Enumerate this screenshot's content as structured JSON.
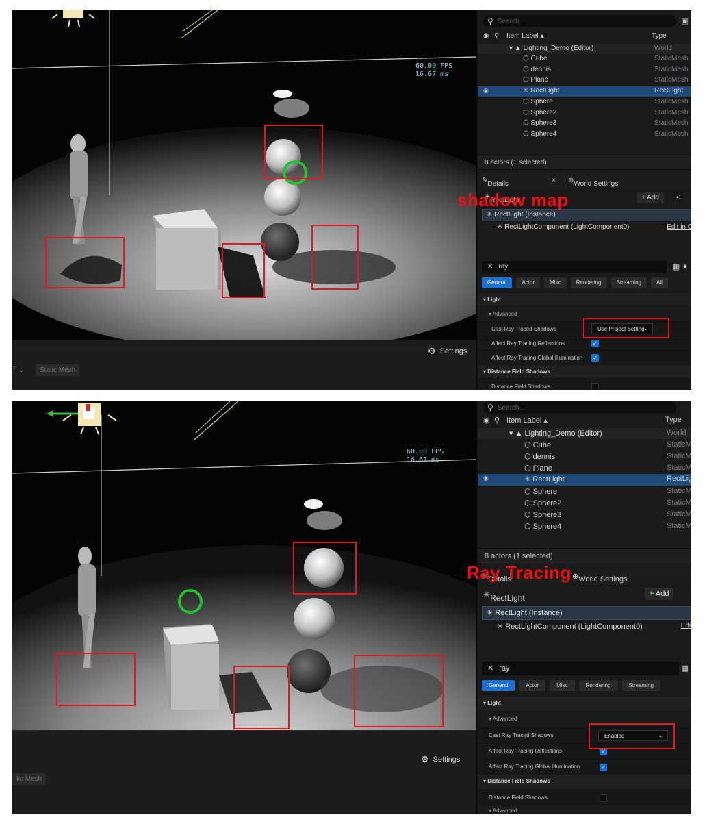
{
  "top": {
    "annotation": "shadow map",
    "viewport": {
      "fps": "60.00 FPS",
      "ms": "16.67 ms"
    },
    "toolbar": {
      "settings_label": "Settings",
      "static_mesh_label": "Static Mesh"
    },
    "outliner": {
      "search_placeholder": "Search...",
      "col_label": "Item Label ▴",
      "col_type": "Type",
      "rows": [
        {
          "label": "Lighting_Demo (Editor)",
          "type": "World"
        },
        {
          "label": "Cube",
          "type": "StaticMesh"
        },
        {
          "label": "dennis",
          "type": "StaticMesh"
        },
        {
          "label": "Plane",
          "type": "StaticMesh"
        },
        {
          "label": "RectLight",
          "type": "RectLight"
        },
        {
          "label": "Sphere",
          "type": "StaticMesh"
        },
        {
          "label": "Sphere2",
          "type": "StaticMesh"
        },
        {
          "label": "Sphere3",
          "type": "StaticMesh"
        },
        {
          "label": "Sphere4",
          "type": "StaticMesh"
        }
      ],
      "count": "8 actors (1 selected)"
    },
    "details": {
      "tab_details": "Details",
      "tab_world": "World Settings",
      "object_name": "RectLight",
      "add_label": "Add",
      "instance": "RectLight (Instance)",
      "component": "RectLightComponent (LightComponent0)",
      "edit_link": "Edit in C",
      "filter": "ray",
      "categories": [
        "General",
        "Actor",
        "Misc",
        "Rendering",
        "Streaming",
        "All"
      ],
      "section_light": "Light",
      "sub_advanced": "Advanced",
      "prop_cast": "Cast Ray Traced Shadows",
      "prop_cast_value": "Use Project Setting",
      "prop_refl": "Affect Ray Tracing Reflections",
      "prop_gi": "Affect Ray Tracing Global Illumination",
      "section_dfs": "Distance Field Shadows",
      "prop_dfs": "Distance Field Shadows"
    }
  },
  "bottom": {
    "annotation": "Ray Tracing",
    "viewport": {
      "fps": "60.00 FPS",
      "ms": "16.67 ms"
    },
    "toolbar": {
      "settings_label": "Settings",
      "static_mesh_label": "tic Mesh"
    },
    "outliner": {
      "search_placeholder": "Search...",
      "col_label": "Item Label ▴",
      "col_type": "Type",
      "rows": [
        {
          "label": "Lighting_Demo (Editor)",
          "type": "World"
        },
        {
          "label": "Cube",
          "type": "StaticM"
        },
        {
          "label": "dennis",
          "type": "StaticM"
        },
        {
          "label": "Plane",
          "type": "StaticM"
        },
        {
          "label": "RectLight",
          "type": "RectLig"
        },
        {
          "label": "Sphere",
          "type": "StaticM"
        },
        {
          "label": "Sphere2",
          "type": "StaticM"
        },
        {
          "label": "Sphere3",
          "type": "StaticM"
        },
        {
          "label": "Sphere4",
          "type": "StaticM"
        }
      ],
      "count": "8 actors (1 selected)"
    },
    "details": {
      "tab_details": "Details",
      "tab_world": "World Settings",
      "object_name": "RectLight",
      "add_label": "Add",
      "instance": "RectLight (Instance)",
      "component": "RectLightComponent (LightComponent0)",
      "edit_link": "Edit",
      "filter": "ray",
      "categories": [
        "General",
        "Actor",
        "Misc",
        "Rendering",
        "Streaming"
      ],
      "section_light": "Light",
      "sub_advanced": "Advanced",
      "prop_cast": "Cast Ray Traced Shadows",
      "prop_cast_value": "Enabled",
      "prop_refl": "Affect Ray Tracing Reflections",
      "prop_gi": "Affect Ray Tracing Global Illumination",
      "section_dfs": "Distance Field Shadows",
      "prop_dfs": "Distance Field Shadows",
      "sub_advanced2": "Advanced"
    }
  },
  "colors": {
    "annotation_red": "#e01b1b",
    "selection_blue": "#1e4a7a",
    "accent_blue": "#1e6fd0",
    "gizmo_green": "#22c02a"
  }
}
